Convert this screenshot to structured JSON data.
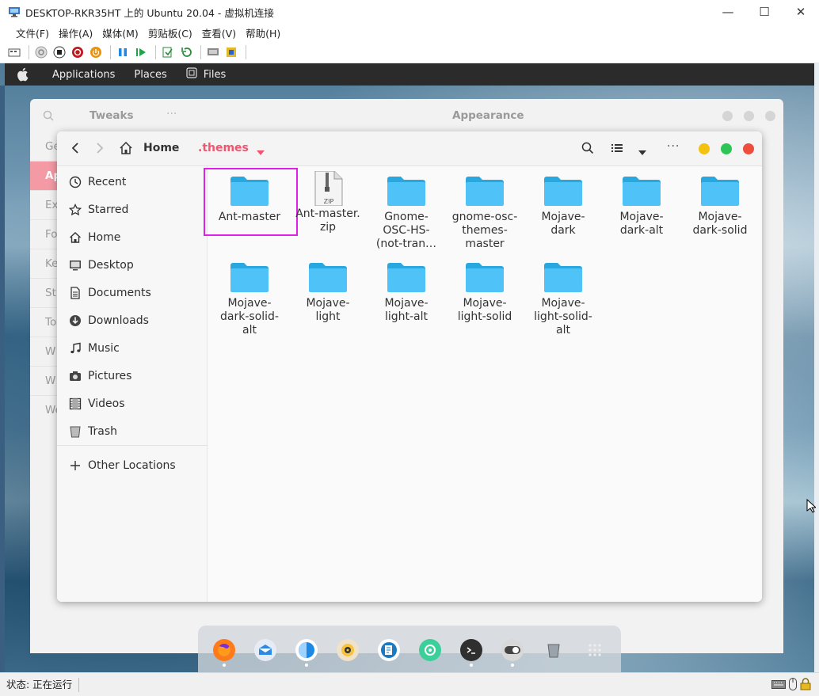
{
  "host": {
    "title": "DESKTOP-RKR35HT 上的 Ubuntu 20.04 - 虚拟机连接",
    "menu": [
      "文件(F)",
      "操作(A)",
      "媒体(M)",
      "剪贴板(C)",
      "查看(V)",
      "帮助(H)"
    ],
    "status": "状态: 正在运行"
  },
  "panel": {
    "applications": "Applications",
    "places": "Places",
    "files": "Files"
  },
  "tweaks": {
    "title": "Tweaks",
    "section_title": "Appearance",
    "items": [
      "Ge",
      "Ap",
      "Ex",
      "Fo",
      "Ke",
      "St",
      "To",
      "W",
      "W",
      "We"
    ]
  },
  "files": {
    "path_home": "Home",
    "path_current": ".themes",
    "sidebar": [
      {
        "label": "Recent",
        "icon": "clock-icon"
      },
      {
        "label": "Starred",
        "icon": "star-icon"
      },
      {
        "label": "Home",
        "icon": "home-icon"
      },
      {
        "label": "Desktop",
        "icon": "desktop-icon"
      },
      {
        "label": "Documents",
        "icon": "document-icon"
      },
      {
        "label": "Downloads",
        "icon": "download-icon"
      },
      {
        "label": "Music",
        "icon": "music-icon"
      },
      {
        "label": "Pictures",
        "icon": "camera-icon"
      },
      {
        "label": "Videos",
        "icon": "film-icon"
      },
      {
        "label": "Trash",
        "icon": "trash-icon"
      }
    ],
    "other_locations": "Other Locations",
    "items": [
      {
        "name": "Ant-master",
        "type": "folder",
        "selected": true
      },
      {
        "name": "Ant-master.\nzip",
        "type": "zip"
      },
      {
        "name": "Gnome-\nOSC-HS-\n(not-tran…",
        "type": "folder"
      },
      {
        "name": "gnome-osc-\nthemes-\nmaster",
        "type": "folder"
      },
      {
        "name": "Mojave-\ndark",
        "type": "folder"
      },
      {
        "name": "Mojave-\ndark-alt",
        "type": "folder"
      },
      {
        "name": "Mojave-\ndark-solid",
        "type": "folder"
      },
      {
        "name": "Mojave-\ndark-solid-\nalt",
        "type": "folder"
      },
      {
        "name": "Mojave-\nlight",
        "type": "folder"
      },
      {
        "name": "Mojave-\nlight-alt",
        "type": "folder"
      },
      {
        "name": "Mojave-\nlight-solid",
        "type": "folder"
      },
      {
        "name": "Mojave-\nlight-solid-\nalt",
        "type": "folder"
      }
    ],
    "zip_badge": "ZIP"
  },
  "colors": {
    "accent": "#f05670",
    "folder": "#4fc3f7",
    "selection": "#e020e8"
  }
}
